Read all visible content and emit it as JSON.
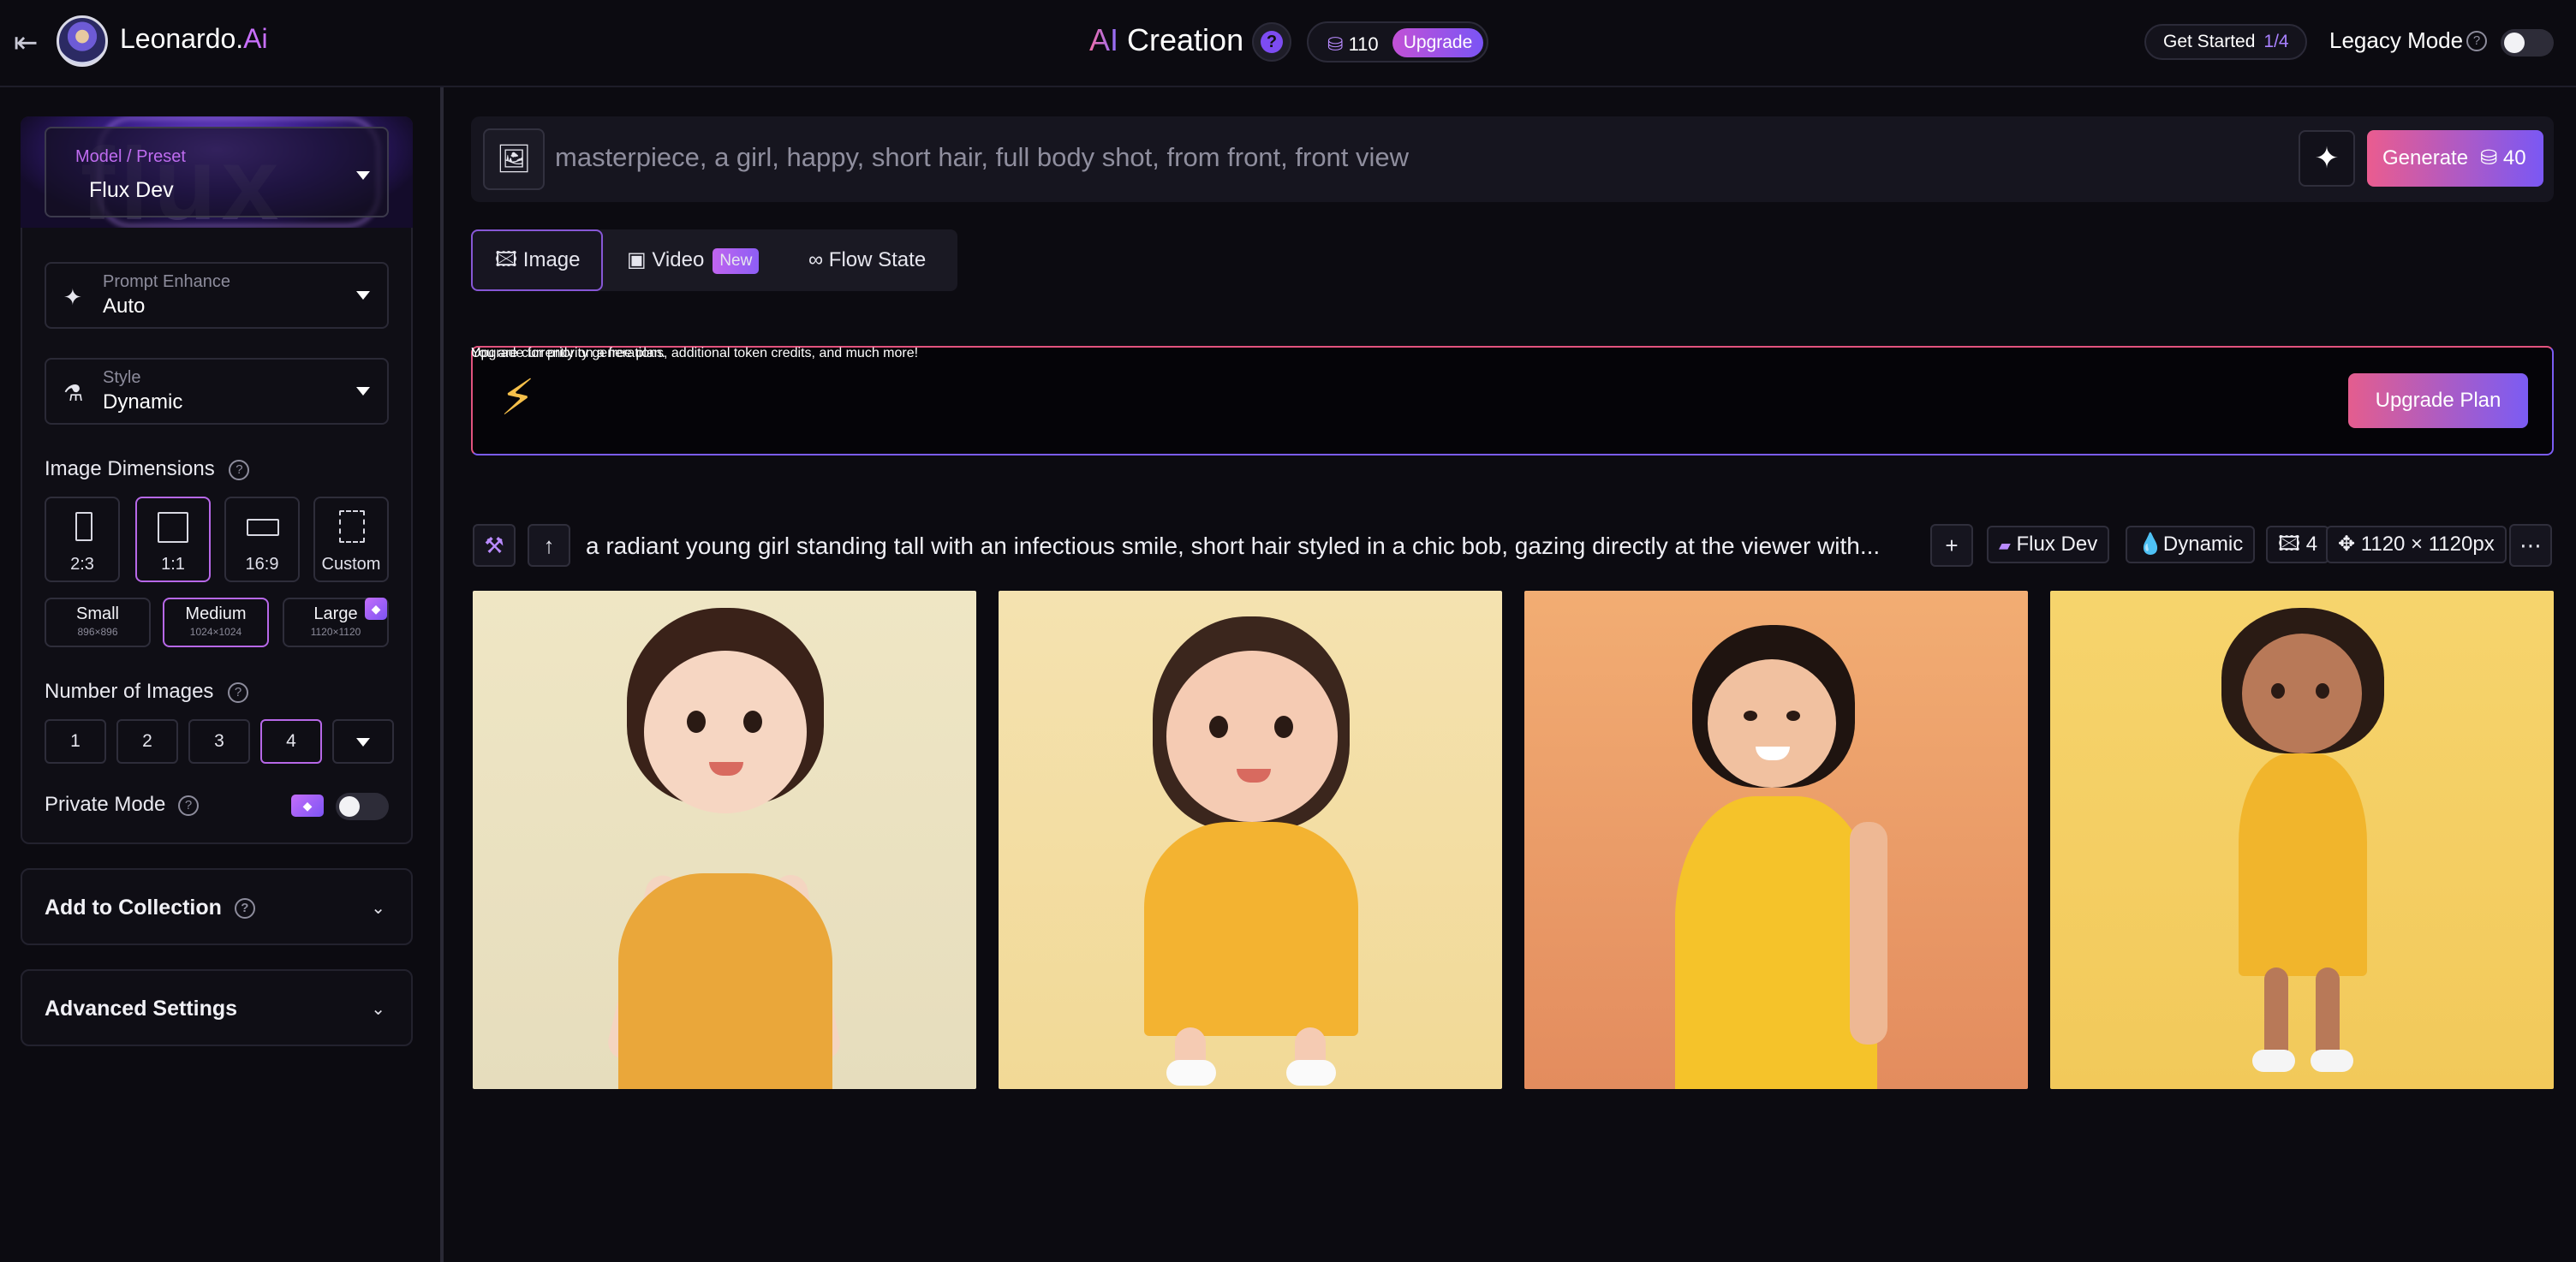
{
  "header": {
    "brand_name": "Leonardo.",
    "brand_suffix": "Ai",
    "title_ai": "AI",
    "title_rest": " Creation",
    "tokens": "110",
    "upgrade_label": "Upgrade",
    "get_started_label": "Get Started",
    "get_started_progress": "1/4",
    "legacy_mode_label": "Legacy Mode",
    "legacy_mode_on": false
  },
  "sidebar": {
    "model_label": "Model / Preset",
    "model_value": "Flux Dev",
    "model_bg_word": "flux",
    "prompt_enhance_label": "Prompt Enhance",
    "prompt_enhance_value": "Auto",
    "style_label": "Style",
    "style_value": "Dynamic",
    "image_dimensions_title": "Image Dimensions",
    "aspect_ratios": [
      "2:3",
      "1:1",
      "16:9",
      "Custom"
    ],
    "selected_aspect": "1:1",
    "sizes": [
      {
        "label": "Small",
        "dims": "896×896"
      },
      {
        "label": "Medium",
        "dims": "1024×1024"
      },
      {
        "label": "Large",
        "dims": "1120×1120"
      }
    ],
    "selected_size": "Medium",
    "number_of_images_title": "Number of Images",
    "number_options": [
      "1",
      "2",
      "3",
      "4"
    ],
    "selected_number": "4",
    "private_mode_label": "Private Mode",
    "private_mode_on": false,
    "add_to_collection_label": "Add to Collection",
    "advanced_settings_label": "Advanced Settings"
  },
  "main": {
    "prompt_placeholder": "masterpiece, a girl, happy, short hair, full body shot, from front, front view",
    "generate_label": "Generate",
    "generate_cost": "40",
    "tabs": [
      {
        "label": "Image",
        "selected": true
      },
      {
        "label": "Video",
        "badge": "New"
      },
      {
        "label": "Flow State"
      }
    ],
    "banner_line1": "You are currently on a free plan.",
    "banner_line2": "Upgrade for priority generations, additional token credits, and much more!",
    "upgrade_plan_label": "Upgrade Plan",
    "generation": {
      "prompt": "a radiant young girl standing tall with an infectious smile, short hair styled in a chic bob, gazing directly at the viewer with...",
      "model": "Flux Dev",
      "style": "Dynamic",
      "count": "4",
      "size": "1120 × 1120px"
    },
    "images": [
      {
        "alt": "cartoon girl in orange sundress on cream background"
      },
      {
        "alt": "3d girl in yellow dress with white sneakers"
      },
      {
        "alt": "photo of smiling girl in yellow dress on orange background"
      },
      {
        "alt": "3d girl in yellow dress on yellow background"
      }
    ]
  },
  "colors": {
    "accent_purple": "#b768e8",
    "gradient_pink": "#e45d8e",
    "gradient_violet": "#7b5cf3",
    "background": "#0c0b11"
  }
}
